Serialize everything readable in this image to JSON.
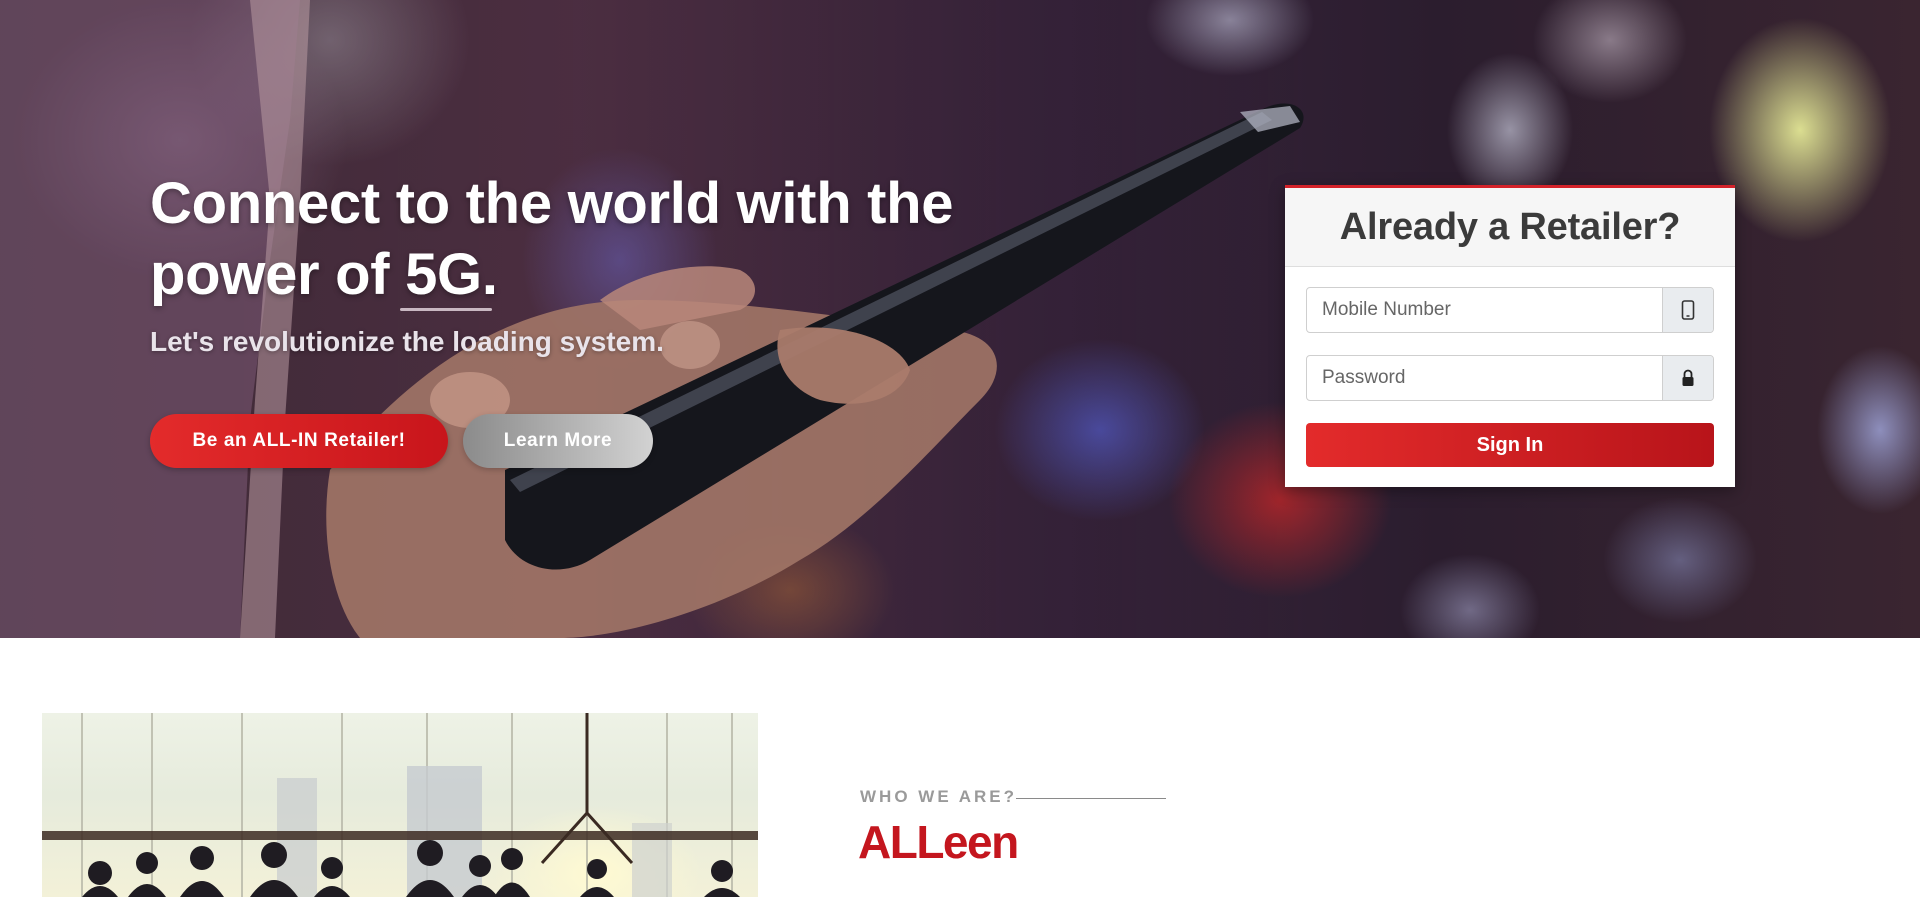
{
  "hero": {
    "title": "Connect to the world with the power of 5G.",
    "subtitle": "Let's revolutionize the loading system.",
    "primary_button": "Be an ALL-IN Retailer!",
    "secondary_button": "Learn More"
  },
  "login": {
    "title": "Already a Retailer?",
    "mobile_placeholder": "Mobile Number",
    "password_placeholder": "Password",
    "mobile_icon": "mobile-phone-icon",
    "password_icon": "lock-icon",
    "submit_label": "Sign In"
  },
  "about": {
    "eyebrow": "WHO WE ARE?",
    "brand": "ALLeen",
    "image": "business-team-silhouette-photo"
  },
  "colors": {
    "brand_red": "#c4161e",
    "button_red": "#e32b2b",
    "button_gray": "#a8a8a8",
    "card_border": "#d4222a"
  }
}
